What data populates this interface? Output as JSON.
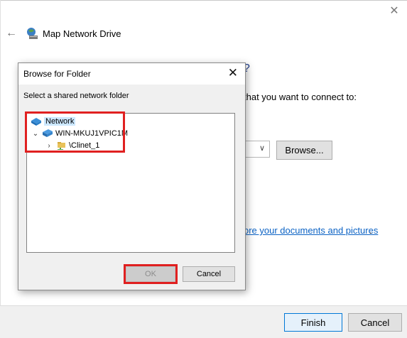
{
  "wizard": {
    "title": "Map Network Drive",
    "question_fragment": "?",
    "instruction_fragment": "that you want to connect to:",
    "browse_label": "Browse...",
    "link_fragment": "ore your documents and pictures",
    "link_suffix": ".",
    "finish_label": "Finish",
    "cancel_label": "Cancel"
  },
  "dialog": {
    "title": "Browse for Folder",
    "caption": "Select a shared network folder",
    "tree": [
      {
        "label": "Network",
        "selected": true,
        "icon": "network-icon"
      },
      {
        "label": "WIN-MKUJ1VPIC1M",
        "expanded": true,
        "icon": "computer-icon"
      },
      {
        "label": "\\Clinet_1",
        "expanded": false,
        "icon": "shared-folder-icon"
      }
    ],
    "ok_label": "OK",
    "cancel_label": "Cancel"
  },
  "colors": {
    "highlight": "#e02020",
    "selection": "#cce8ff",
    "link": "#0b62c4",
    "heading": "#1e3c8c"
  }
}
